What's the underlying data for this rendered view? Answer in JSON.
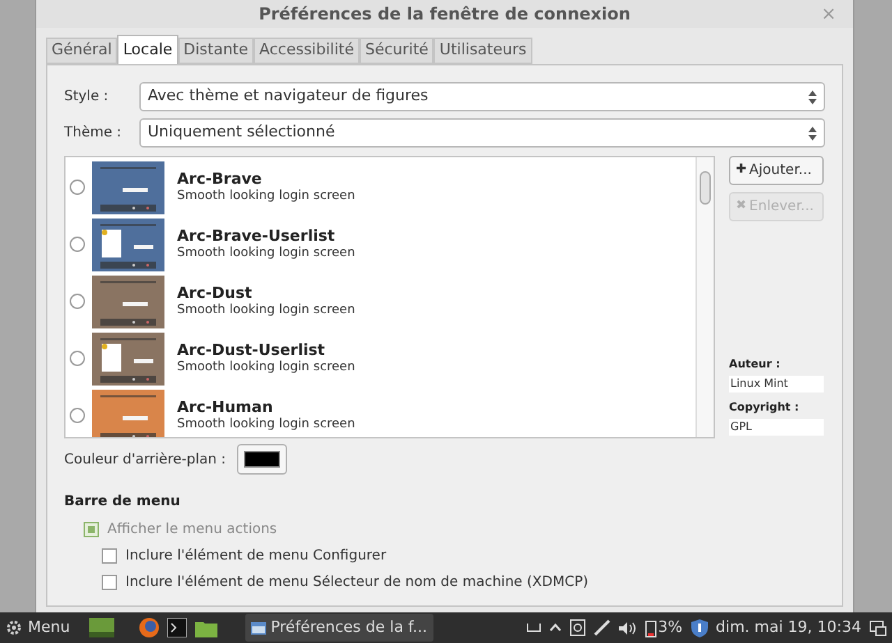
{
  "window": {
    "title": "Préférences de la fenêtre de connexion",
    "close": "×"
  },
  "tabs": [
    {
      "label": "Général",
      "selected": false
    },
    {
      "label": "Locale",
      "selected": true
    },
    {
      "label": "Distante",
      "selected": false
    },
    {
      "label": "Accessibilité",
      "selected": false
    },
    {
      "label": "Sécurité",
      "selected": false
    },
    {
      "label": "Utilisateurs",
      "selected": false
    }
  ],
  "style": {
    "label": "Style :",
    "value": "Avec thème et navigateur de figures"
  },
  "theme": {
    "label": "Thème :",
    "value": "Uniquement sélectionné"
  },
  "themes": [
    {
      "name": "Arc-Brave",
      "description": "Smooth looking login screen",
      "selected": false,
      "kind": "plain",
      "color": "#4f6f9c"
    },
    {
      "name": "Arc-Brave-Userlist",
      "description": "Smooth looking login screen",
      "selected": false,
      "kind": "userlist",
      "color": "#4f6f9c"
    },
    {
      "name": "Arc-Dust",
      "description": "Smooth looking login screen",
      "selected": false,
      "kind": "plain",
      "color": "#8a7462"
    },
    {
      "name": "Arc-Dust-Userlist",
      "description": "Smooth looking login screen",
      "selected": false,
      "kind": "userlist",
      "color": "#8a7462"
    },
    {
      "name": "Arc-Human",
      "description": "Smooth looking login screen",
      "selected": false,
      "kind": "plain",
      "color": "#d9854a"
    }
  ],
  "buttons": [
    {
      "label": "Ajouter...",
      "icon": "✚",
      "disabled": false
    },
    {
      "label": "Enlever...",
      "icon": "✖",
      "disabled": true
    }
  ],
  "info": [
    {
      "label": "Auteur :",
      "value": "Linux Mint"
    },
    {
      "label": "Copyright :",
      "value": "GPL"
    }
  ],
  "background": {
    "label": "Couleur d'arrière-plan :",
    "color": "#000000"
  },
  "menu_bar": {
    "heading": "Barre de menu",
    "options": [
      {
        "label": "Afficher le menu actions",
        "checked": true,
        "disabled": true,
        "children": [
          {
            "label": "Inclure l'élément de menu Configurer",
            "checked": false,
            "disabled": false
          },
          {
            "label": "Inclure l'élément de menu Sélecteur de nom de machine (XDMCP)",
            "checked": false,
            "disabled": false
          }
        ]
      }
    ]
  },
  "taskbar": {
    "menu": "Menu",
    "window": "Préférences de la f...",
    "battery": "3%",
    "clock": "dim. mai 19, 10:34"
  }
}
